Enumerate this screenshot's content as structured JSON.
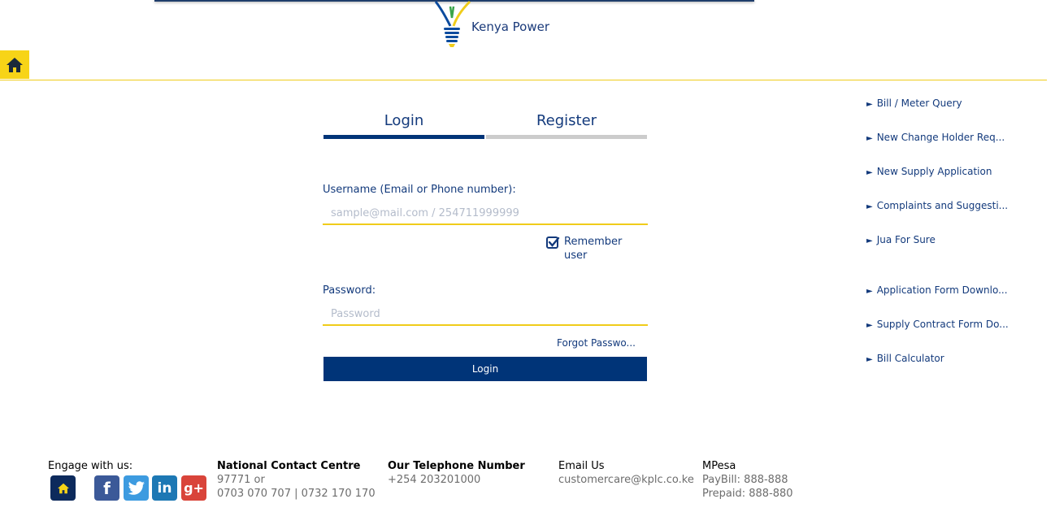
{
  "header": {
    "brand_name": "Kenya Power",
    "home_icon": "home-icon",
    "accent_color": "#f7d417",
    "primary_color": "#003478"
  },
  "auth_tabs": [
    {
      "label": "Login",
      "active": true
    },
    {
      "label": "Register",
      "active": false
    }
  ],
  "login_form": {
    "username_label": "Username (Email or Phone number):",
    "username_placeholder": "sample@mail.com / 254711999999",
    "remember_label": "Remember user",
    "remember_checked": true,
    "password_label": "Password:",
    "password_placeholder": "Password",
    "forgot_label": "Forgot Passwo...",
    "submit_label": "Login"
  },
  "side_links": [
    {
      "label": "Bill / Meter Query"
    },
    {
      "label": "New Change Holder Req..."
    },
    {
      "label": "New Supply Application"
    },
    {
      "label": "Complaints and Suggesti..."
    },
    {
      "label": "Jua For Sure"
    },
    {
      "label": "Application Form Downlo..."
    },
    {
      "label": "Supply Contract Form Do..."
    },
    {
      "label": "Bill Calculator"
    }
  ],
  "footer": {
    "engage_label": "Engage with us:",
    "social_icons": [
      "home-icon",
      "facebook-icon",
      "twitter-icon",
      "linkedin-icon",
      "google-plus-icon"
    ],
    "contact_centre": {
      "title": "National Contact Centre",
      "line1": "97771 or",
      "line2": "0703 070 707 | 0732 170 170"
    },
    "telephone": {
      "title": "Our Telephone Number",
      "line1": "+254 203201000"
    },
    "email": {
      "title": "Email Us",
      "line1": "customercare@kplc.co.ke"
    },
    "mpesa": {
      "title": "MPesa",
      "line1": "PayBill: 888-888",
      "line2": "Prepaid: 888-880"
    }
  }
}
